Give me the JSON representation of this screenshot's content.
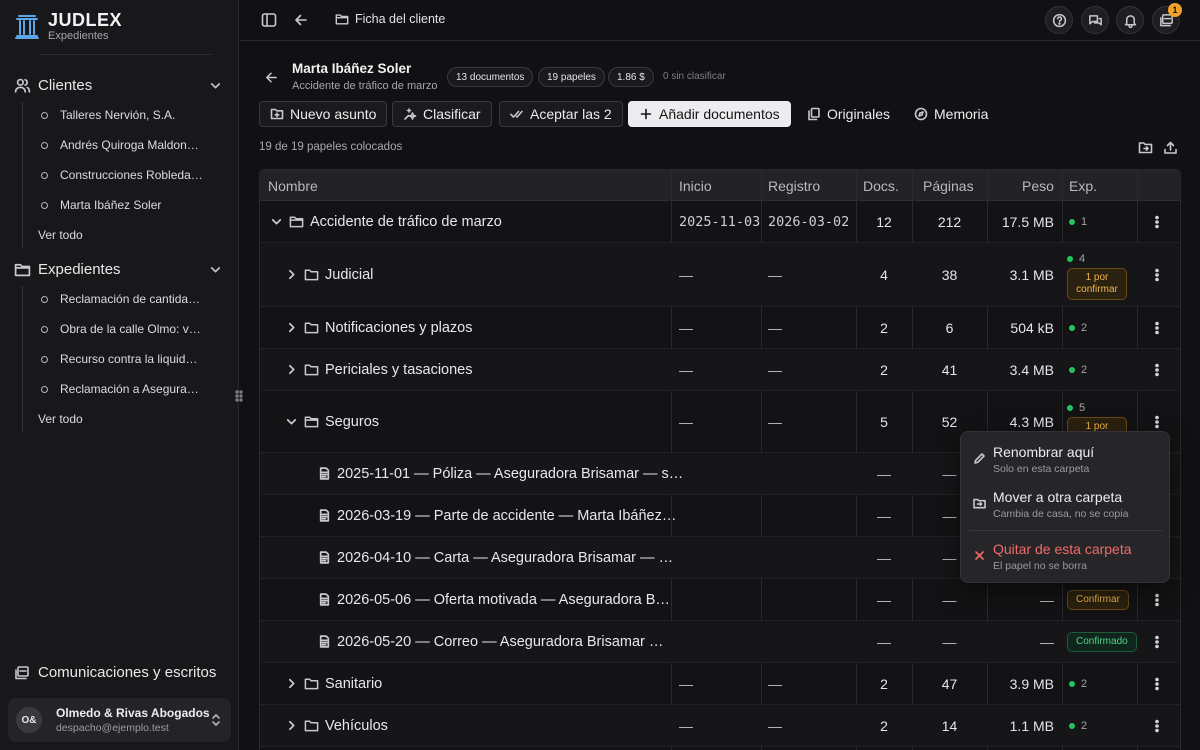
{
  "brand": {
    "name": "JUDLEX",
    "subtitle": "Expedientes"
  },
  "sidebar": {
    "clientes": {
      "label": "Clientes",
      "items": [
        "Talleres Nervión, S.A.",
        "Andrés Quiroga Maldona…",
        "Construcciones Robledal…",
        "Marta Ibáñez Soler"
      ],
      "see_all": "Ver todo"
    },
    "expedientes": {
      "label": "Expedientes",
      "items": [
        "Reclamación de cantidad…",
        "Obra de la calle Olmo: vi…",
        "Recurso contra la liquida…",
        "Reclamación a Asegurad…"
      ],
      "see_all": "Ver todo"
    },
    "comms": "Comunicaciones y escritos",
    "account": {
      "initials": "O&",
      "name": "Olmedo & Rivas Abogados",
      "email": "despacho@ejemplo.test"
    }
  },
  "topbar": {
    "breadcrumb": "Ficha del cliente",
    "notifications": "1"
  },
  "header": {
    "client": "Marta Ibáñez Soler",
    "case": "Accidente de tráfico de marzo",
    "chips": [
      "13 documentos",
      "19 papeles",
      "1.86 $"
    ],
    "unclassified": "0 sin clasificar"
  },
  "actions": {
    "new_matter": "Nuevo asunto",
    "classify": "Clasificar",
    "accept": "Aceptar las 2",
    "add_docs": "Añadir documentos",
    "originals": "Originales",
    "memory": "Memoria"
  },
  "placed_count": "19 de 19 papeles colocados",
  "table": {
    "columns": [
      "Nombre",
      "Inicio",
      "Registro",
      "Docs.",
      "Páginas",
      "Peso",
      "Exp."
    ],
    "rows": [
      {
        "name": "Accidente de tráfico de marzo",
        "start": "2025-11-03",
        "reg": "2026-03-02",
        "docs": "12",
        "pages": "212",
        "size": "17.5 MB",
        "exp": "1"
      },
      {
        "name": "Judicial",
        "start": "—",
        "reg": "—",
        "docs": "4",
        "pages": "38",
        "size": "3.1 MB",
        "exp": "4",
        "pill": "1 por confirmar"
      },
      {
        "name": "Notificaciones y plazos",
        "start": "—",
        "reg": "—",
        "docs": "2",
        "pages": "6",
        "size": "504 kB",
        "exp": "2"
      },
      {
        "name": "Periciales y tasaciones",
        "start": "—",
        "reg": "—",
        "docs": "2",
        "pages": "41",
        "size": "3.4 MB",
        "exp": "2"
      },
      {
        "name": "Seguros",
        "start": "—",
        "reg": "—",
        "docs": "5",
        "pages": "52",
        "size": "4.3 MB",
        "exp": "5",
        "pill": "1 por"
      },
      {
        "name": "2025-11-01 — Póliza — Aseguradora Brisamar — s…",
        "docs": "—",
        "pages": "—"
      },
      {
        "name": "2026-03-19 — Parte de accidente — Marta Ibáñez…",
        "docs": "—",
        "pages": "—"
      },
      {
        "name": "2026-04-10 — Carta — Aseguradora Brisamar — …",
        "docs": "—",
        "pages": "—"
      },
      {
        "name": "2026-05-06 — Oferta motivada — Aseguradora B…",
        "docs": "—",
        "pages": "—",
        "size": "—",
        "pill": "Confirmar"
      },
      {
        "name": "2026-05-20 — Correo — Aseguradora Brisamar …",
        "docs": "—",
        "pages": "—",
        "size": "—",
        "pill": "Confirmado"
      },
      {
        "name": "Sanitario",
        "start": "—",
        "reg": "—",
        "docs": "2",
        "pages": "47",
        "size": "3.9 MB",
        "exp": "2"
      },
      {
        "name": "Vehículos",
        "start": "—",
        "reg": "—",
        "docs": "2",
        "pages": "14",
        "size": "1.1 MB",
        "exp": "2"
      }
    ]
  },
  "context_menu": {
    "rename": {
      "label": "Renombrar aquí",
      "sub": "Solo en esta carpeta"
    },
    "move": {
      "label": "Mover a otra carpeta",
      "sub": "Cambia de casa, no se copia"
    },
    "remove": {
      "label": "Quitar de esta carpeta",
      "sub": "El papel no se borra"
    }
  },
  "colors": {
    "accent": "#5aa6e8",
    "ok": "#22c55e",
    "warn": "#f0b54a",
    "danger": "#ef6a6a"
  }
}
